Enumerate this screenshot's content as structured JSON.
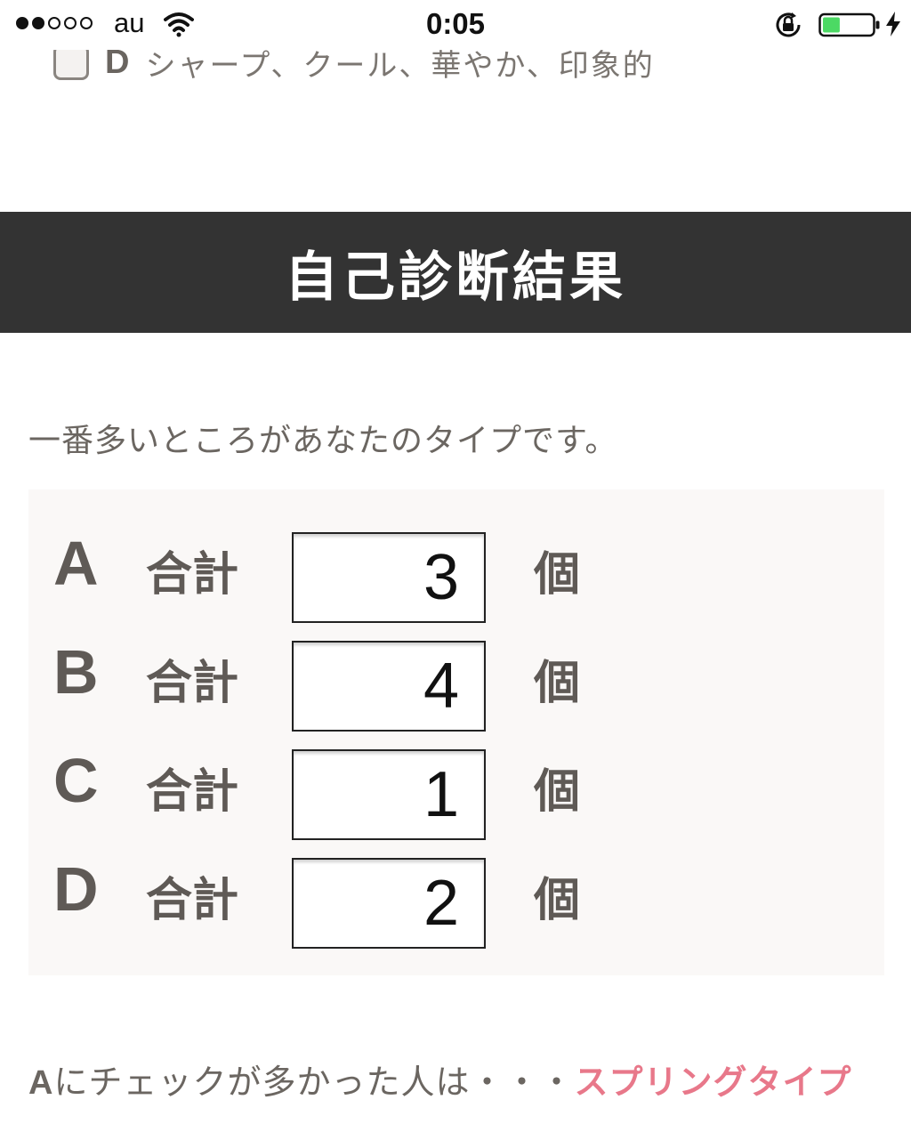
{
  "status_bar": {
    "carrier": "au",
    "time": "0:05",
    "signal_bars_filled": 2,
    "signal_bars_total": 5,
    "battery_level": 0.35,
    "battery_color": "#4cd964",
    "icons": [
      "wifi-icon",
      "rotation-lock-icon",
      "battery-icon",
      "charging-bolt-icon"
    ]
  },
  "previous_option": {
    "letter": "D",
    "text": "シャープ、クール、華やか、印象的"
  },
  "section": {
    "title": "自己診断結果"
  },
  "intro": "一番多いところがあなたのタイプです。",
  "scores": [
    {
      "letter": "A",
      "label": "合計",
      "value": "3",
      "unit": "個"
    },
    {
      "letter": "B",
      "label": "合計",
      "value": "4",
      "unit": "個"
    },
    {
      "letter": "C",
      "label": "合計",
      "value": "1",
      "unit": "個"
    },
    {
      "letter": "D",
      "label": "合計",
      "value": "2",
      "unit": "個"
    }
  ],
  "result": {
    "key": "A",
    "text": "にチェックが多かった人は・・・",
    "type_link": "スプリングタイプ"
  },
  "colors": {
    "header_bg": "#333333",
    "panel_bg": "#faf8f7",
    "text": "#5f5a56",
    "link": "#e8788a"
  }
}
